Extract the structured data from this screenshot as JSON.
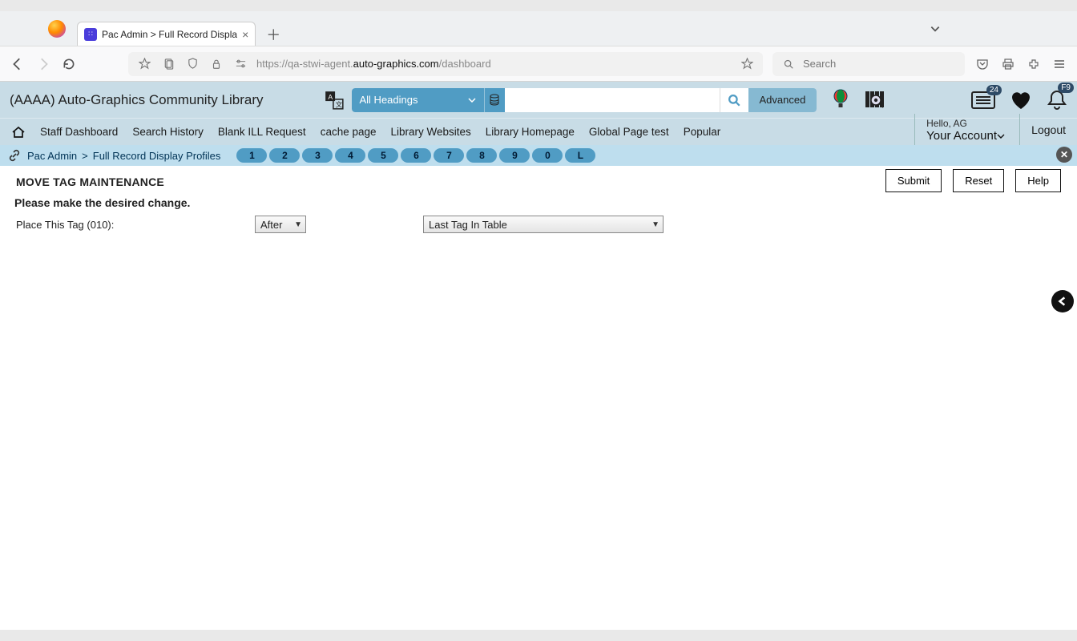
{
  "window": {
    "title_bar_buttons": [
      "minimize",
      "maximize",
      "close"
    ]
  },
  "browser": {
    "tab_title": "Pac Admin > Full Record Displa",
    "url_pre": "https://qa-stwi-agent.",
    "url_host": "auto-graphics.com",
    "url_path": "/dashboard",
    "search_placeholder": "Search"
  },
  "app": {
    "library_name": "(AAAA) Auto-Graphics Community Library",
    "scope_label": "All Headings",
    "advanced_label": "Advanced",
    "list_badge": "24",
    "bell_badge": "F9",
    "nav": [
      "Staff Dashboard",
      "Search History",
      "Blank ILL Request",
      "cache page",
      "Library Websites",
      "Library Homepage",
      "Global Page test",
      "Popular"
    ],
    "hello": "Hello, AG",
    "your_account": "Your Account",
    "logout": "Logout"
  },
  "crumb": {
    "path1": "Pac Admin",
    "sep": ">",
    "path2": "Full Record Display Profiles",
    "pills": [
      "1",
      "2",
      "3",
      "4",
      "5",
      "6",
      "7",
      "8",
      "9",
      "0",
      "L"
    ]
  },
  "page": {
    "title": "MOVE TAG MAINTENANCE",
    "subtitle": "Please make the desired change.",
    "field_label": "Place This Tag (010):",
    "position_value": "After",
    "target_value": "Last Tag In Table",
    "submit": "Submit",
    "reset": "Reset",
    "help": "Help"
  }
}
